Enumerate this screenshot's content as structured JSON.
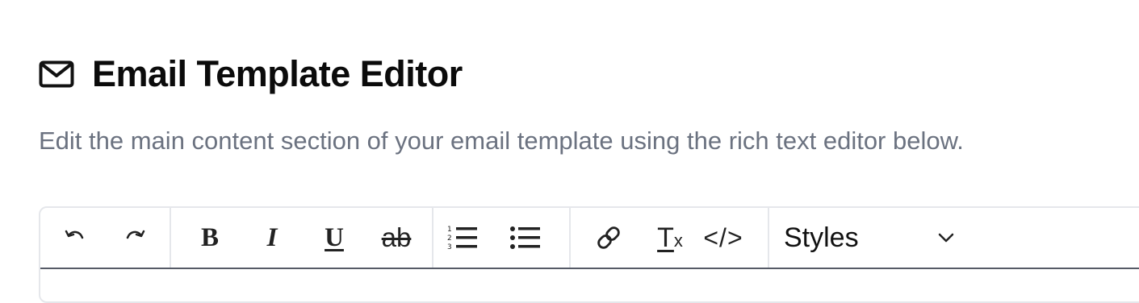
{
  "header": {
    "icon": "mail-icon",
    "title": "Email Template Editor",
    "subtitle": "Edit the main content section of your email template using the rich text editor below."
  },
  "toolbar": {
    "history": [
      {
        "name": "undo-button",
        "icon": "undo-icon"
      },
      {
        "name": "redo-button",
        "icon": "redo-icon"
      }
    ],
    "formatting": {
      "bold_label": "B",
      "italic_label": "I",
      "underline_label": "U",
      "strikethrough_label": "ab"
    },
    "lists": [
      {
        "name": "ordered-list-button",
        "icon": "ordered-list-icon"
      },
      {
        "name": "bullet-list-button",
        "icon": "bullet-list-icon"
      }
    ],
    "insert": {
      "link_icon": "link-icon",
      "clear_format_label": "T",
      "clear_format_sub": "x",
      "code_label": "</>"
    },
    "styles": {
      "label": "Styles",
      "icon": "chevron-down-icon"
    }
  },
  "colors": {
    "text": "#0b0b0b",
    "muted": "#6b7280",
    "border": "#e5e7eb",
    "toolbar_divider": "#555a66"
  }
}
